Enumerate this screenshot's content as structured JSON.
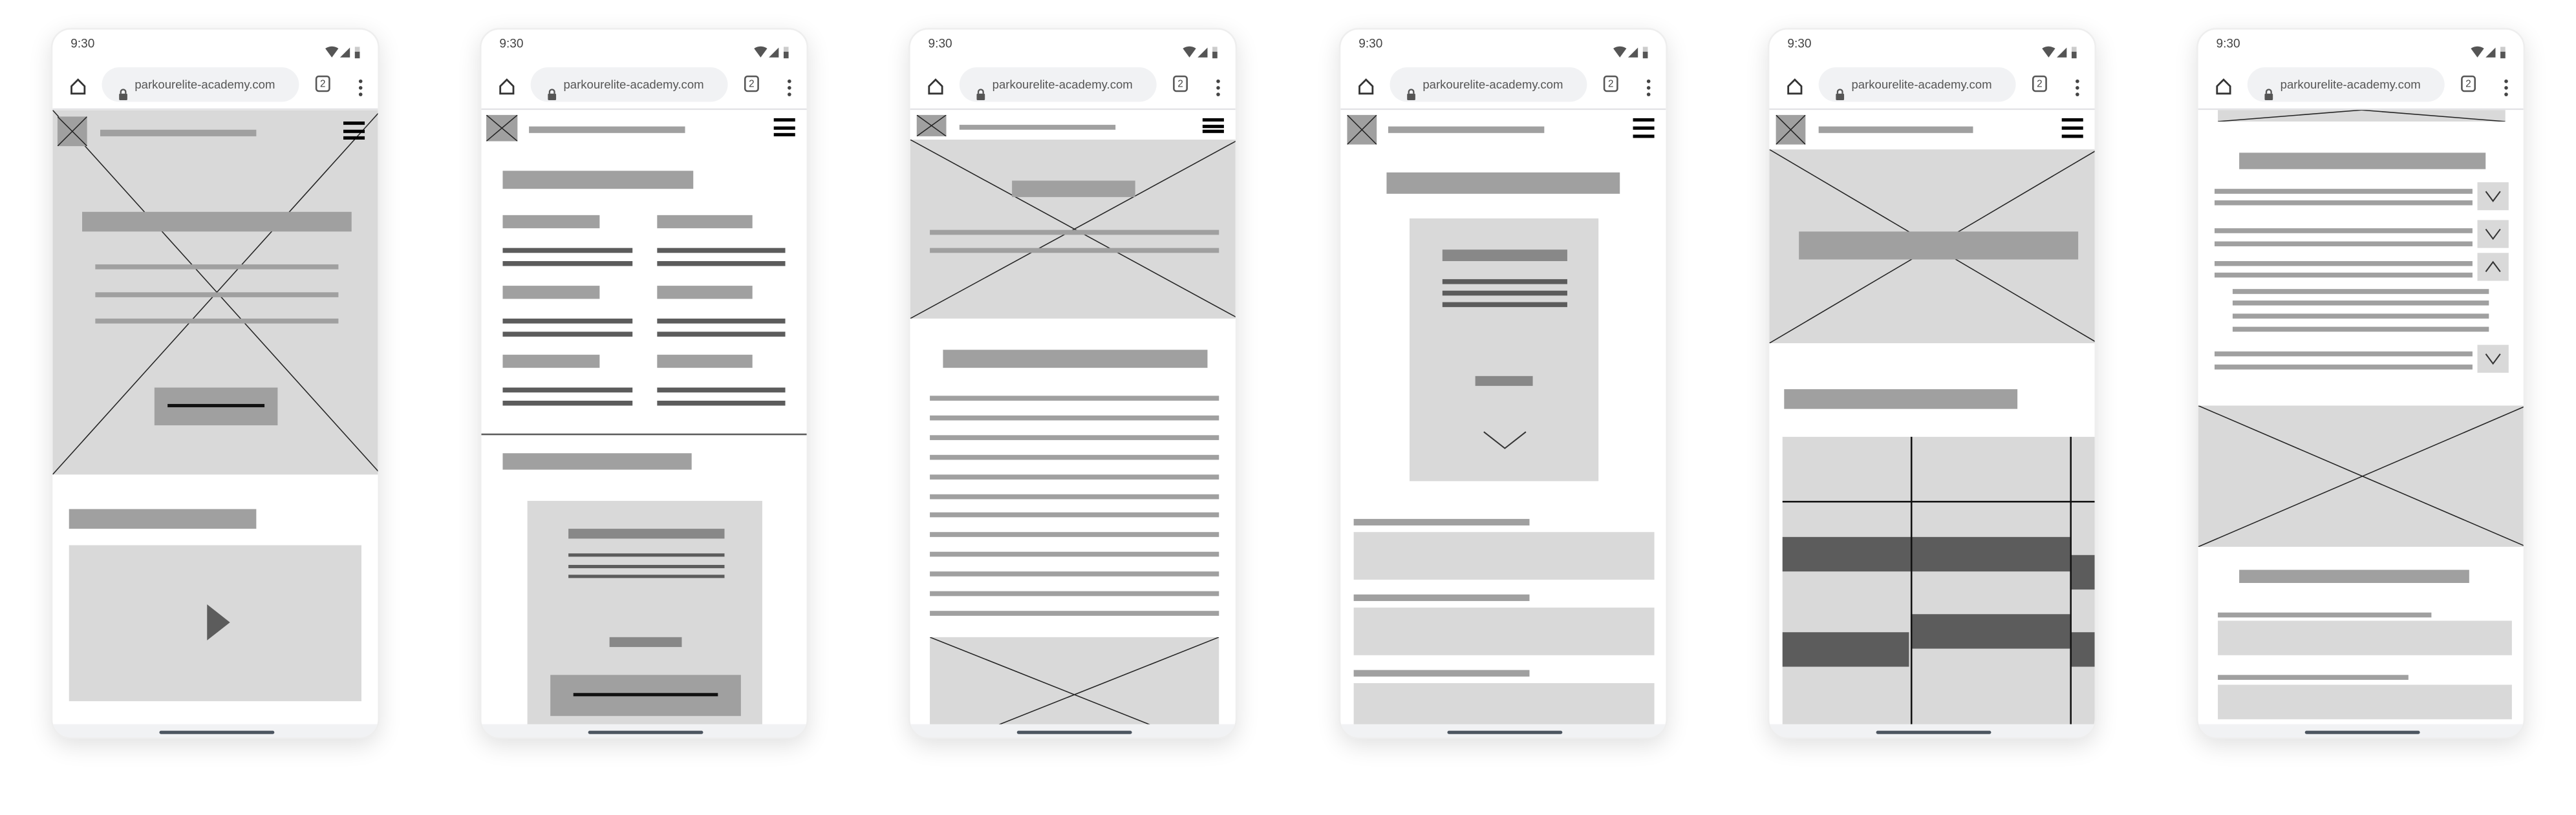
{
  "phones": [
    {
      "time": "9:30",
      "url": "parkourelite-academy.com",
      "tab_count": "2"
    },
    {
      "time": "9:30",
      "url": "parkourelite-academy.com",
      "tab_count": "2"
    },
    {
      "time": "9:30",
      "url": "parkourelite-academy.com",
      "tab_count": "2"
    },
    {
      "time": "9:30",
      "url": "parkourelite-academy.com",
      "tab_count": "2"
    },
    {
      "time": "9:30",
      "url": "parkourelite-academy.com",
      "tab_count": "2"
    },
    {
      "time": "9:30",
      "url": "parkourelite-academy.com",
      "tab_count": "2"
    }
  ],
  "colors": {
    "placeholder": "#d9d9d9",
    "text_bar": "#a0a0a0",
    "dark_block": "#5c5c5c"
  }
}
